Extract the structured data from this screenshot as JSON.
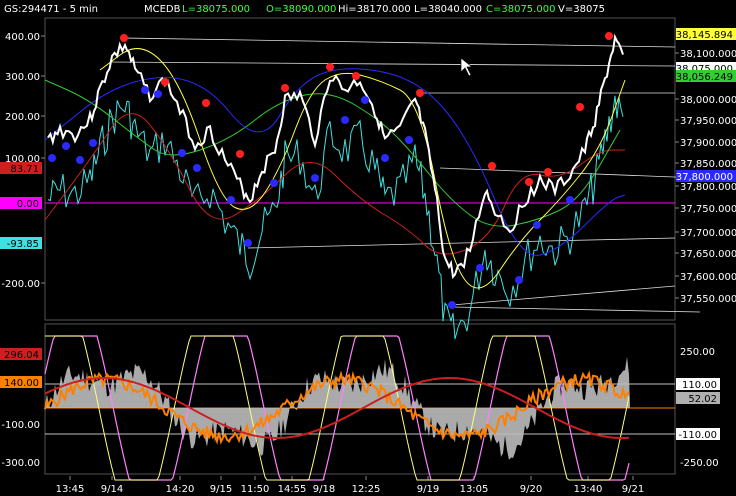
{
  "header": {
    "symbol": "GS:294471 - 5 min",
    "source": "MCEDB",
    "low": "L=38075.000",
    "open": "O=38090.000",
    "high": "Hi=38170.000",
    "close_low": "L=38040.000",
    "close": "C=38075.000",
    "volume": "V=38075"
  },
  "colors": {
    "background": "#000000",
    "text": "#ffffff",
    "header_green": "#40ff40",
    "price": "#ffffff",
    "cyan": "#40e0e0",
    "red": "#cc2020",
    "green": "#33cc33",
    "yellow": "#ffff40",
    "blue": "#2a2aff",
    "magenta": "#ff00ff",
    "orange": "#ff8000"
  },
  "upper_panel": {
    "left_axis": [
      "400.00",
      "300.00",
      "200.00",
      "100.00",
      "-200.00"
    ],
    "right_axis": [
      "38,100.000",
      "38,000.000",
      "37,950.000",
      "37,900.000",
      "37,850.000",
      "37,800.000",
      "37,750.000",
      "37,700.000",
      "37,650.000",
      "37,600.000",
      "37,550.000"
    ],
    "left_badges": [
      {
        "text": "83.71",
        "color": "#cc2020"
      },
      {
        "text": "0.00",
        "color": "#ff00ff"
      },
      {
        "text": "-93.85",
        "color": "#40e0e0"
      }
    ],
    "right_badges": [
      {
        "text": "38,145.894",
        "color": "#ffff40"
      },
      {
        "text": "38,075.000",
        "color": "#ffffff"
      },
      {
        "text": "38,056.249",
        "color": "#33cc33"
      },
      {
        "text": "37,800.000",
        "color": "#2a2aff"
      }
    ]
  },
  "lower_panel": {
    "left_axis": [
      "-100.00",
      "-300.00"
    ],
    "right_axis": [
      "250.00",
      "-250.00"
    ],
    "left_badges": [
      {
        "text": "296.04",
        "color": "#cc2020"
      },
      {
        "text": "140.00",
        "color": "#ff8000"
      }
    ],
    "right_badges": [
      {
        "text": "110.00",
        "color": "#ffffff"
      },
      {
        "text": "52.02",
        "color": "#b0b0b0"
      },
      {
        "text": "-110.00",
        "color": "#ffffff"
      }
    ]
  },
  "time_axis": [
    "13:45",
    "9/14",
    "14:20",
    "9/15",
    "11:50",
    "14:55",
    "9/18",
    "12:25",
    "9/19",
    "13:05",
    "9/20",
    "13:40",
    "9/21"
  ]
}
